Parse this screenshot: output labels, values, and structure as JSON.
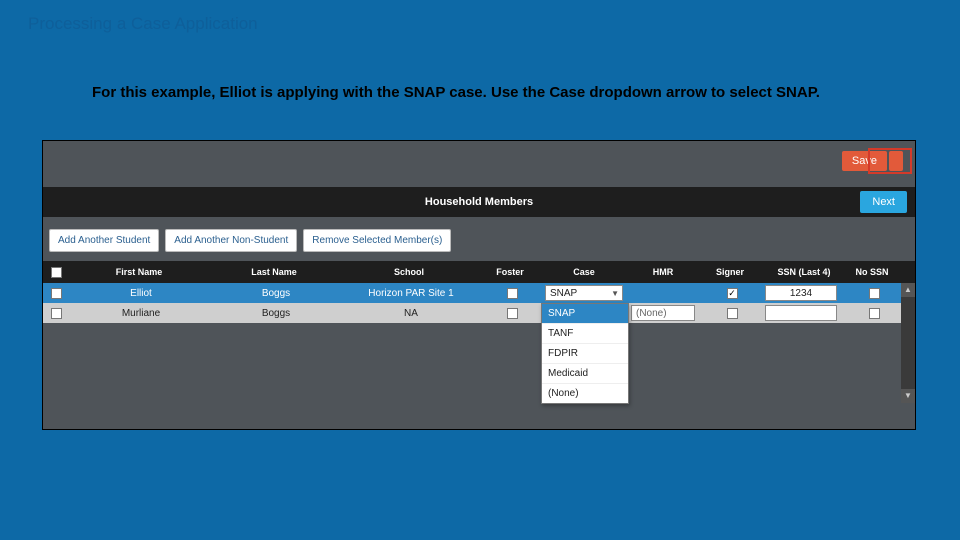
{
  "slide": {
    "title": "Processing a Case Application",
    "instruction": "For this example, Elliot is applying with the SNAP case. Use the Case dropdown arrow to select SNAP."
  },
  "toolbar": {
    "save_label": "Save",
    "next_label": "Next"
  },
  "section": {
    "title": "Household Members"
  },
  "actions": {
    "add_student": "Add Another Student",
    "add_non_student": "Add Another Non-Student",
    "remove_selected": "Remove Selected Member(s)"
  },
  "columns": {
    "first": "First Name",
    "last": "Last Name",
    "school": "School",
    "foster": "Foster",
    "case": "Case",
    "hmr": "HMR",
    "signer": "Signer",
    "ssn": "SSN (Last 4)",
    "nossn": "No SSN"
  },
  "rows": [
    {
      "first": "Elliot",
      "last": "Boggs",
      "school": "Horizon PAR Site 1",
      "foster": false,
      "case_selected": "SNAP",
      "hmr": "",
      "signer": true,
      "ssn": "1234",
      "nossn": false
    },
    {
      "first": "Murliane",
      "last": "Boggs",
      "school": "NA",
      "foster": false,
      "case_selected": "",
      "hmr": "(None)",
      "signer": false,
      "ssn": "",
      "nossn": false
    }
  ],
  "case_options": [
    "SNAP",
    "TANF",
    "FDPIR",
    "Medicaid",
    "(None)"
  ]
}
